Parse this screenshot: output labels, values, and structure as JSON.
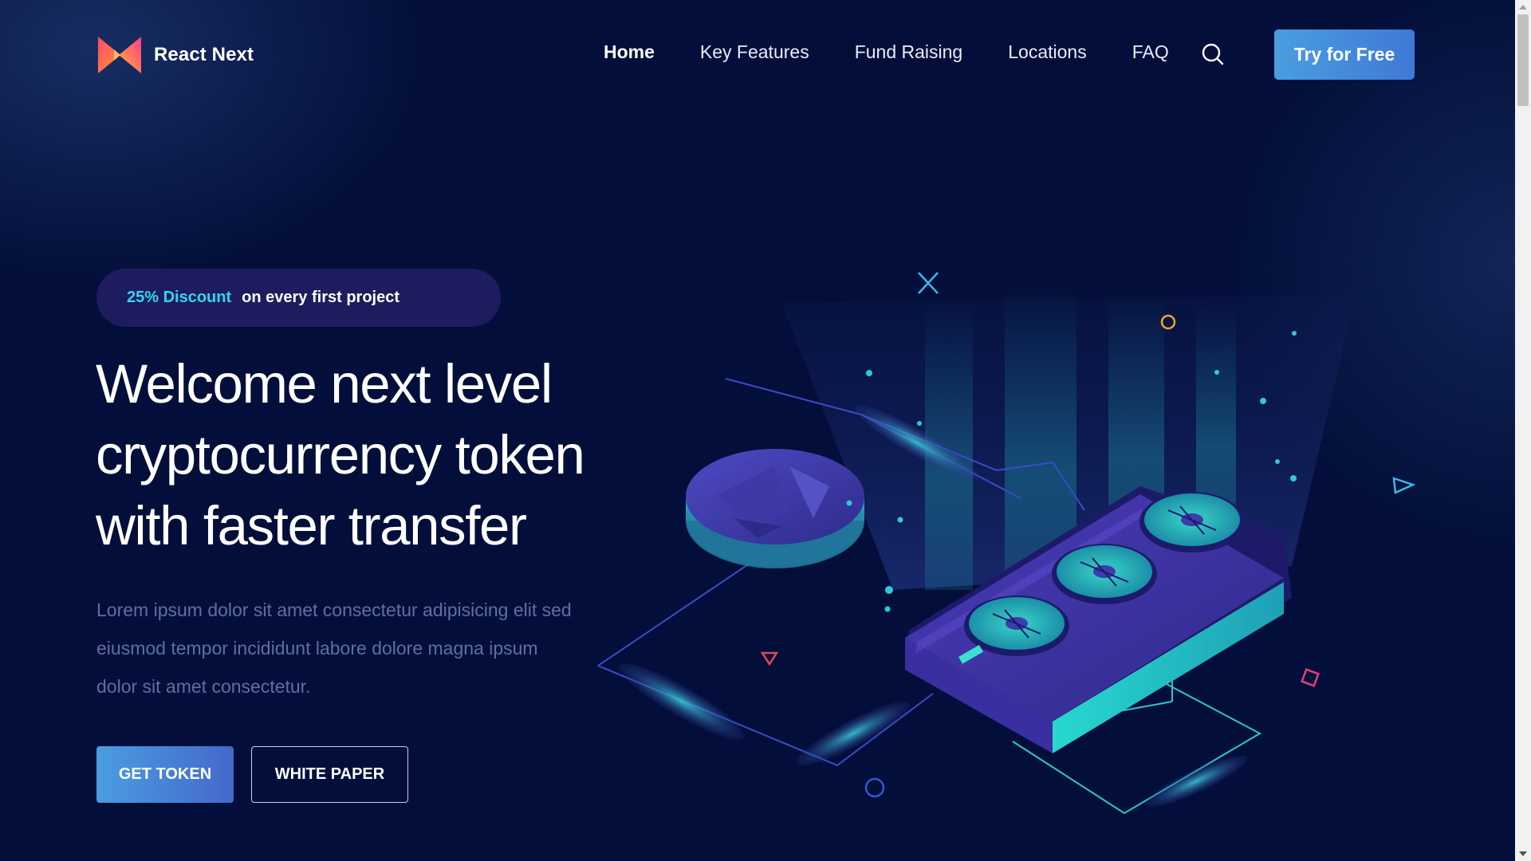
{
  "header": {
    "logo_text": "React Next",
    "nav": [
      {
        "label": "Home",
        "active": true
      },
      {
        "label": "Key Features"
      },
      {
        "label": "Fund Raising"
      },
      {
        "label": "Locations"
      },
      {
        "label": "FAQ"
      }
    ],
    "search_icon": "search-icon",
    "cta_label": "Try for Free"
  },
  "hero": {
    "badge_highlight": "25% Discount",
    "badge_text": "on every first project",
    "title_lines": [
      "Welcome next level",
      "cryptocurrency token",
      "with faster transfer"
    ],
    "description_lines": [
      "Lorem ipsum dolor sit amet consectetur adipisicing elit sed",
      "eiusmod tempor incididunt labore dolore magna ipsum",
      "dolor sit amet consectetur."
    ],
    "primary_button": "GET TOKEN",
    "secondary_button": "WHITE PAPER"
  },
  "colors": {
    "background": "#030f3a",
    "accent_cyan": "#33d6f0",
    "button_blue": "#4a9de0",
    "badge_bg": "#1c1c5e",
    "illustration_teal": "#3fd6d0",
    "illustration_purple": "#3b34a0"
  }
}
